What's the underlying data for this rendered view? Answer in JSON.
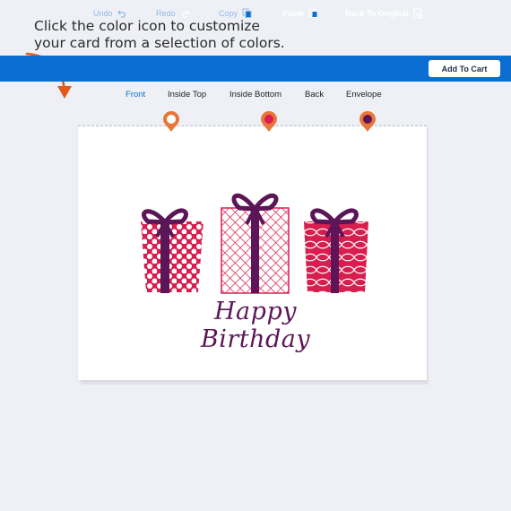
{
  "instruction": {
    "line1": "Click the color icon to customize",
    "line2": "your card from a selection of colors."
  },
  "toolbar": {
    "undo_label": "Undo",
    "redo_label": "Redo",
    "copy_label": "Copy",
    "paste_label": "Paste",
    "back_to_original_label": "Back To Original",
    "add_to_cart_label": "Add To Cart",
    "background_color": "#0a6fd1"
  },
  "tabs": [
    {
      "label": "Front",
      "active": true
    },
    {
      "label": "Inside Top",
      "active": false
    },
    {
      "label": "Inside Bottom",
      "active": false
    },
    {
      "label": "Back",
      "active": false
    },
    {
      "label": "Envelope",
      "active": false
    }
  ],
  "color_pins": [
    {
      "name": "color-pin-orange",
      "color": "#e8753a"
    },
    {
      "name": "color-pin-crimson",
      "color": "#d81e4e"
    },
    {
      "name": "color-pin-plum",
      "color": "#5c1657"
    }
  ],
  "card": {
    "greeting": "Happy Birthday",
    "gift_colors": {
      "box": "#d81e4e",
      "ribbon": "#5c1657"
    }
  },
  "icons": {
    "arrow": "curved-arrow-icon",
    "undo": "undo-icon",
    "redo": "redo-icon",
    "copy": "copy-icon",
    "paste": "paste-icon",
    "back_to_original": "restore-icon"
  }
}
